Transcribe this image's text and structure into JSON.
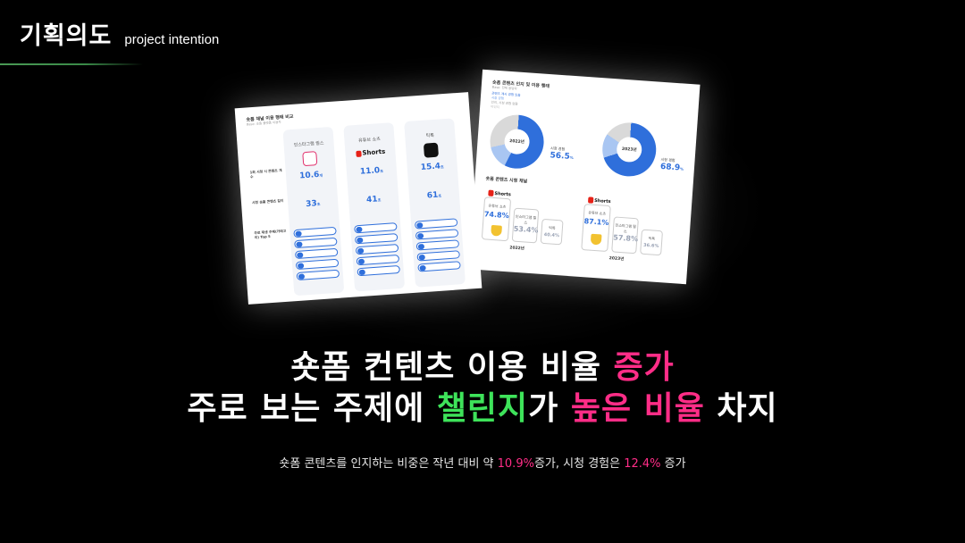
{
  "header": {
    "title": "기획의도",
    "subtitle": "project intention"
  },
  "card1": {
    "title": "숏폼 채널 이용 행태 비교",
    "subtitle": "Base: 숏폼 플랫폼 이용자",
    "platforms": [
      {
        "name": "인스타그램 릴스",
        "count": "10.6",
        "count_unit": "개",
        "time": "33",
        "time_unit": "초"
      },
      {
        "name": "유튜브 쇼츠",
        "logo": "Shorts",
        "count": "11.0",
        "count_unit": "초",
        "time": "41",
        "time_unit": "초"
      },
      {
        "name": "틱톡",
        "count": "15.4",
        "count_unit": "초",
        "time": "61",
        "time_unit": "초"
      }
    ],
    "row_labels": [
      "1회 시청 시 콘텐츠 개수",
      "시청 숏폼 콘텐츠 길이",
      "주로 재생 주제(카테고리) Top 5"
    ]
  },
  "card2": {
    "title": "숏폼 콘텐츠 인지 및 이용 행태",
    "subtitle": "Base: 전체 응답자",
    "legend": [
      "콘텐츠 제시 경험 있음",
      "시청 경험",
      "인지, 시청 경험 없음",
      "비인지"
    ],
    "donuts": [
      {
        "year": "2022년",
        "label": "시청 경험",
        "value": "56.5",
        "unit": "%",
        "seg_small": "29.5",
        "seg_mid": "14.0",
        "seg_big": "56.5"
      },
      {
        "year": "2023년",
        "label": "시청 경험",
        "value": "68.9",
        "unit": "%",
        "seg_small": "16.5",
        "seg_mid": "14.6",
        "seg_big": "68.9"
      }
    ],
    "section2_title": "숏폼 콘텐츠 시청 채널",
    "groups": [
      {
        "year": "2022년",
        "bars": [
          {
            "label": "유튜브 쇼츠",
            "value": "74.8",
            "unit": "%"
          },
          {
            "label": "인스타그램 릴스",
            "value": "53.4",
            "unit": "%"
          },
          {
            "label": "틱톡",
            "value": "40.4",
            "unit": "%"
          }
        ]
      },
      {
        "year": "2023년",
        "bars": [
          {
            "label": "유튜브 쇼츠",
            "value": "87.1",
            "unit": "%"
          },
          {
            "label": "인스타그램 릴스",
            "value": "57.8",
            "unit": "%"
          },
          {
            "label": "틱톡",
            "value": "36.6",
            "unit": "%"
          }
        ]
      }
    ],
    "shorts_logo": "Shorts"
  },
  "headline": {
    "line1_a": "숏폼 컨텐츠 이용 비율 ",
    "line1_b": "증가",
    "line2_a": "주로 보는 주제에 ",
    "line2_b": "챌린지",
    "line2_c": "가 ",
    "line2_d": "높은 비율",
    "line2_e": " 차지"
  },
  "caption": {
    "a": "숏폼 콘텐츠를 인지하는 비중은 작년 대비 약 ",
    "b": "10.9%",
    "c": "증가, 시청 경험은 ",
    "d": "12.4%",
    "e": " 증가"
  },
  "colors": {
    "pink": "#ff2d87",
    "green": "#3ee35a",
    "accent_blue": "#2f6fdb"
  }
}
